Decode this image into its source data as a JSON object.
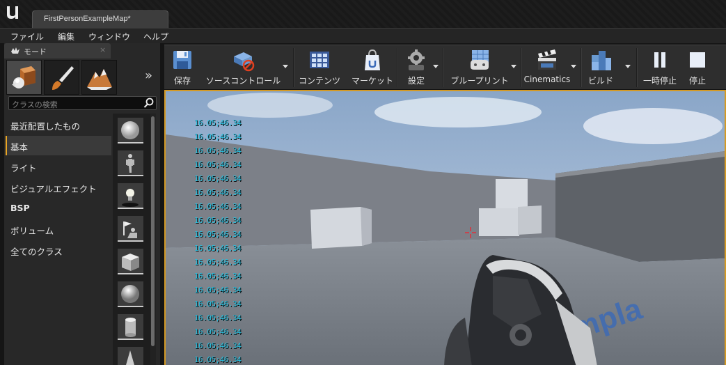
{
  "window": {
    "document_tab": "FirstPersonExampleMap*"
  },
  "menu": [
    "ファイル",
    "編集",
    "ウィンドウ",
    "ヘルプ"
  ],
  "modes_panel": {
    "title": "モード",
    "close_glyph": "×",
    "more_glyph": "»",
    "search_placeholder": "クラスの検索",
    "categories": [
      "最近配置したもの",
      "基本",
      "ライト",
      "ビジュアルエフェクト",
      "BSP",
      "ボリューム",
      "全てのクラス"
    ],
    "active_category": "基本",
    "mode_tabs": [
      "place-mode",
      "paint-mode",
      "landscape-mode"
    ],
    "thumbnails": [
      "empty-actor",
      "empty-character",
      "point-light",
      "player-start",
      "cube",
      "sphere",
      "cylinder",
      "cone"
    ]
  },
  "toolbar": {
    "buttons": [
      {
        "label": "保存",
        "icon": "save-icon"
      },
      {
        "label": "ソースコントロール",
        "icon": "source-control-icon"
      },
      {
        "label": "コンテンツ",
        "icon": "content-icon"
      },
      {
        "label": "マーケット",
        "icon": "marketplace-icon"
      },
      {
        "label": "設定",
        "icon": "settings-icon"
      },
      {
        "label": "ブループリント",
        "icon": "blueprints-icon"
      },
      {
        "label": "Cinematics",
        "icon": "cinematics-icon"
      },
      {
        "label": "ビルド",
        "icon": "build-icon"
      },
      {
        "label": "一時停止",
        "icon": "pause-icon"
      },
      {
        "label": "停止",
        "icon": "stop-icon"
      }
    ]
  },
  "viewport": {
    "stat_lines": [
      "16.05;46.34",
      "16.05;46.34",
      "16.05;46.34",
      "16.05;46.34",
      "16.05;46.34",
      "16.05;46.34",
      "16.05;46.34",
      "16.05;46.34",
      "16.05;46.34",
      "16.05;46.34",
      "16.05;46.34",
      "16.05;46.34",
      "16.05;46.34",
      "16.05;46.34",
      "16.05;46.34",
      "16.05;46.34",
      "16.05;46.34",
      "16.05;46.34"
    ],
    "floor_text": "on  xampla",
    "accent_color": "#d49a25",
    "crosshair_color": "#e0303a"
  }
}
